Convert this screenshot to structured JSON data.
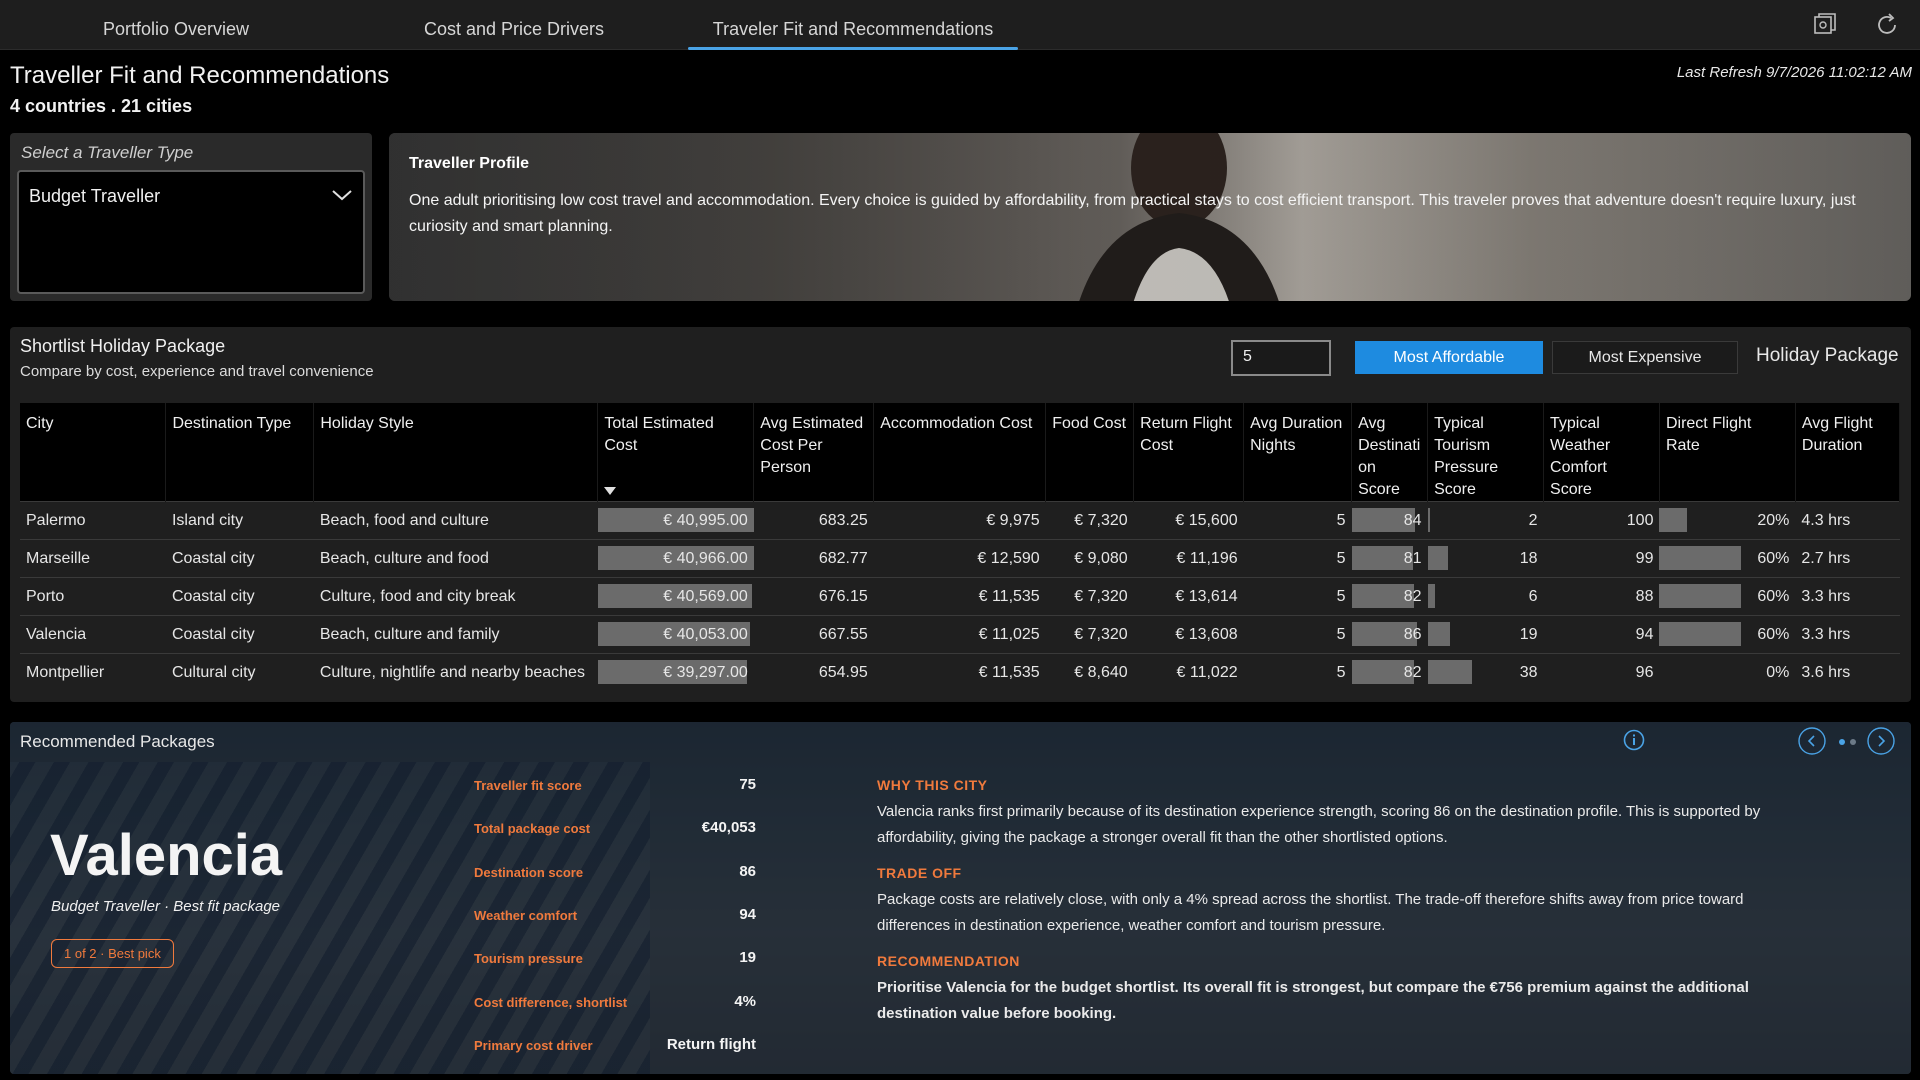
{
  "tabs": [
    {
      "label": "Portfolio Overview"
    },
    {
      "label": "Cost and Price Drivers"
    },
    {
      "label": "Traveler Fit and Recommendations"
    }
  ],
  "header": {
    "title": "Traveller Fit and Recommendations",
    "subtitle": "4 countries . 21 cities",
    "refresh": "Last Refresh 9/7/2026 11:02:12 AM"
  },
  "selector": {
    "label": "Select a Traveller Type",
    "value": "Budget Traveller"
  },
  "profile": {
    "title": "Traveller Profile",
    "text": "One adult prioritising low cost travel and accommodation. Every choice is guided by affordability, from practical stays to cost efficient transport. This traveler proves that adventure doesn't require luxury, just curiosity and smart planning."
  },
  "shortlist": {
    "title": "Shortlist Holiday Package",
    "subtitle": "Compare by cost, experience and travel convenience",
    "top_n": "5",
    "btn_affordable": "Most Affordable",
    "btn_expensive": "Most Expensive",
    "package_label": "Holiday Package",
    "columns": [
      "City",
      "Destination Type",
      "Holiday Style",
      "Total Estimated Cost",
      "Avg Estimated Cost Per Person",
      "Accommodation Cost",
      "Food Cost",
      "Return Flight Cost",
      "Avg Duration Nights",
      "Avg Destinati on Score",
      "Typical Tourism Pressure Score",
      "Typical Weather Comfort Score",
      "Direct Flight Rate",
      "Avg Flight Duration"
    ],
    "rows": [
      {
        "city": "Palermo",
        "type": "Island city",
        "style": "Beach, food and culture",
        "total": "€ 40,995.00",
        "total_v": 40995,
        "pp": "683.25",
        "acc": "€ 9,975",
        "food": "€ 7,320",
        "flight": "€ 15,600",
        "nights": "5",
        "dest": "84",
        "dest_v": 84,
        "pressure": "2",
        "pressure_v": 2,
        "weather": "100",
        "direct": "20%",
        "direct_v": 20,
        "dur": "4.3 hrs"
      },
      {
        "city": "Marseille",
        "type": "Coastal city",
        "style": "Beach, culture and food",
        "total": "€ 40,966.00",
        "total_v": 40966,
        "pp": "682.77",
        "acc": "€ 12,590",
        "food": "€ 9,080",
        "flight": "€ 11,196",
        "nights": "5",
        "dest": "81",
        "dest_v": 81,
        "pressure": "18",
        "pressure_v": 18,
        "weather": "99",
        "direct": "60%",
        "direct_v": 60,
        "dur": "2.7 hrs"
      },
      {
        "city": "Porto",
        "type": "Coastal city",
        "style": "Culture, food and city break",
        "total": "€ 40,569.00",
        "total_v": 40569,
        "pp": "676.15",
        "acc": "€ 11,535",
        "food": "€ 7,320",
        "flight": "€ 13,614",
        "nights": "5",
        "dest": "82",
        "dest_v": 82,
        "pressure": "6",
        "pressure_v": 6,
        "weather": "88",
        "direct": "60%",
        "direct_v": 60,
        "dur": "3.3 hrs"
      },
      {
        "city": "Valencia",
        "type": "Coastal city",
        "style": "Beach, culture and family",
        "total": "€ 40,053.00",
        "total_v": 40053,
        "pp": "667.55",
        "acc": "€ 11,025",
        "food": "€ 7,320",
        "flight": "€ 13,608",
        "nights": "5",
        "dest": "86",
        "dest_v": 86,
        "pressure": "19",
        "pressure_v": 19,
        "weather": "94",
        "direct": "60%",
        "direct_v": 60,
        "dur": "3.3 hrs"
      },
      {
        "city": "Montpellier",
        "type": "Cultural city",
        "style": "Culture, nightlife and nearby beaches",
        "total": "€ 39,297.00",
        "total_v": 39297,
        "pp": "654.95",
        "acc": "€ 11,535",
        "food": "€ 8,640",
        "flight": "€ 11,022",
        "nights": "5",
        "dest": "82",
        "dest_v": 82,
        "pressure": "38",
        "pressure_v": 38,
        "weather": "96",
        "direct": "0%",
        "direct_v": 0,
        "dur": "3.6 hrs"
      }
    ]
  },
  "recommended": {
    "title": "Recommended Packages",
    "city": "Valencia",
    "city_sub": "Budget Traveller · Best fit package",
    "badge": "1 of 2 · Best pick",
    "metrics": [
      {
        "label": "Traveller fit score",
        "value": "75"
      },
      {
        "label": "Total package cost",
        "value": "€40,053"
      },
      {
        "label": "Destination score",
        "value": "86"
      },
      {
        "label": "Weather comfort",
        "value": "94"
      },
      {
        "label": "Tourism pressure",
        "value": "19"
      },
      {
        "label": "Cost difference, shortlist",
        "value": "4%"
      },
      {
        "label": "Primary cost driver",
        "value": "Return flight"
      }
    ],
    "why_h": "WHY THIS CITY",
    "why_p": "Valencia ranks first primarily because of its destination experience strength, scoring 86 on the destination profile. This is supported by affordability, giving the package a stronger overall fit than the other shortlisted options.",
    "trade_h": "TRADE OFF",
    "trade_p": "Package costs are relatively close, with only a 4% spread across the shortlist. The trade-off therefore shifts away from price toward differences in destination experience, weather comfort and tourism pressure.",
    "rec_h": "RECOMMENDATION",
    "rec_p": "Prioritise Valencia for the budget shortlist. Its overall fit is strongest, but compare the €756 premium against the additional destination value before booking.",
    "page_current": 1,
    "page_total": 2
  },
  "colors": {
    "accent": "#1e8be0",
    "highlight": "#f07a3d",
    "bar": "#6b6b6b"
  },
  "icons": [
    "reset-icon",
    "refresh-icon",
    "chevron-down-icon",
    "info-icon",
    "chevron-left-icon",
    "chevron-right-icon"
  ]
}
